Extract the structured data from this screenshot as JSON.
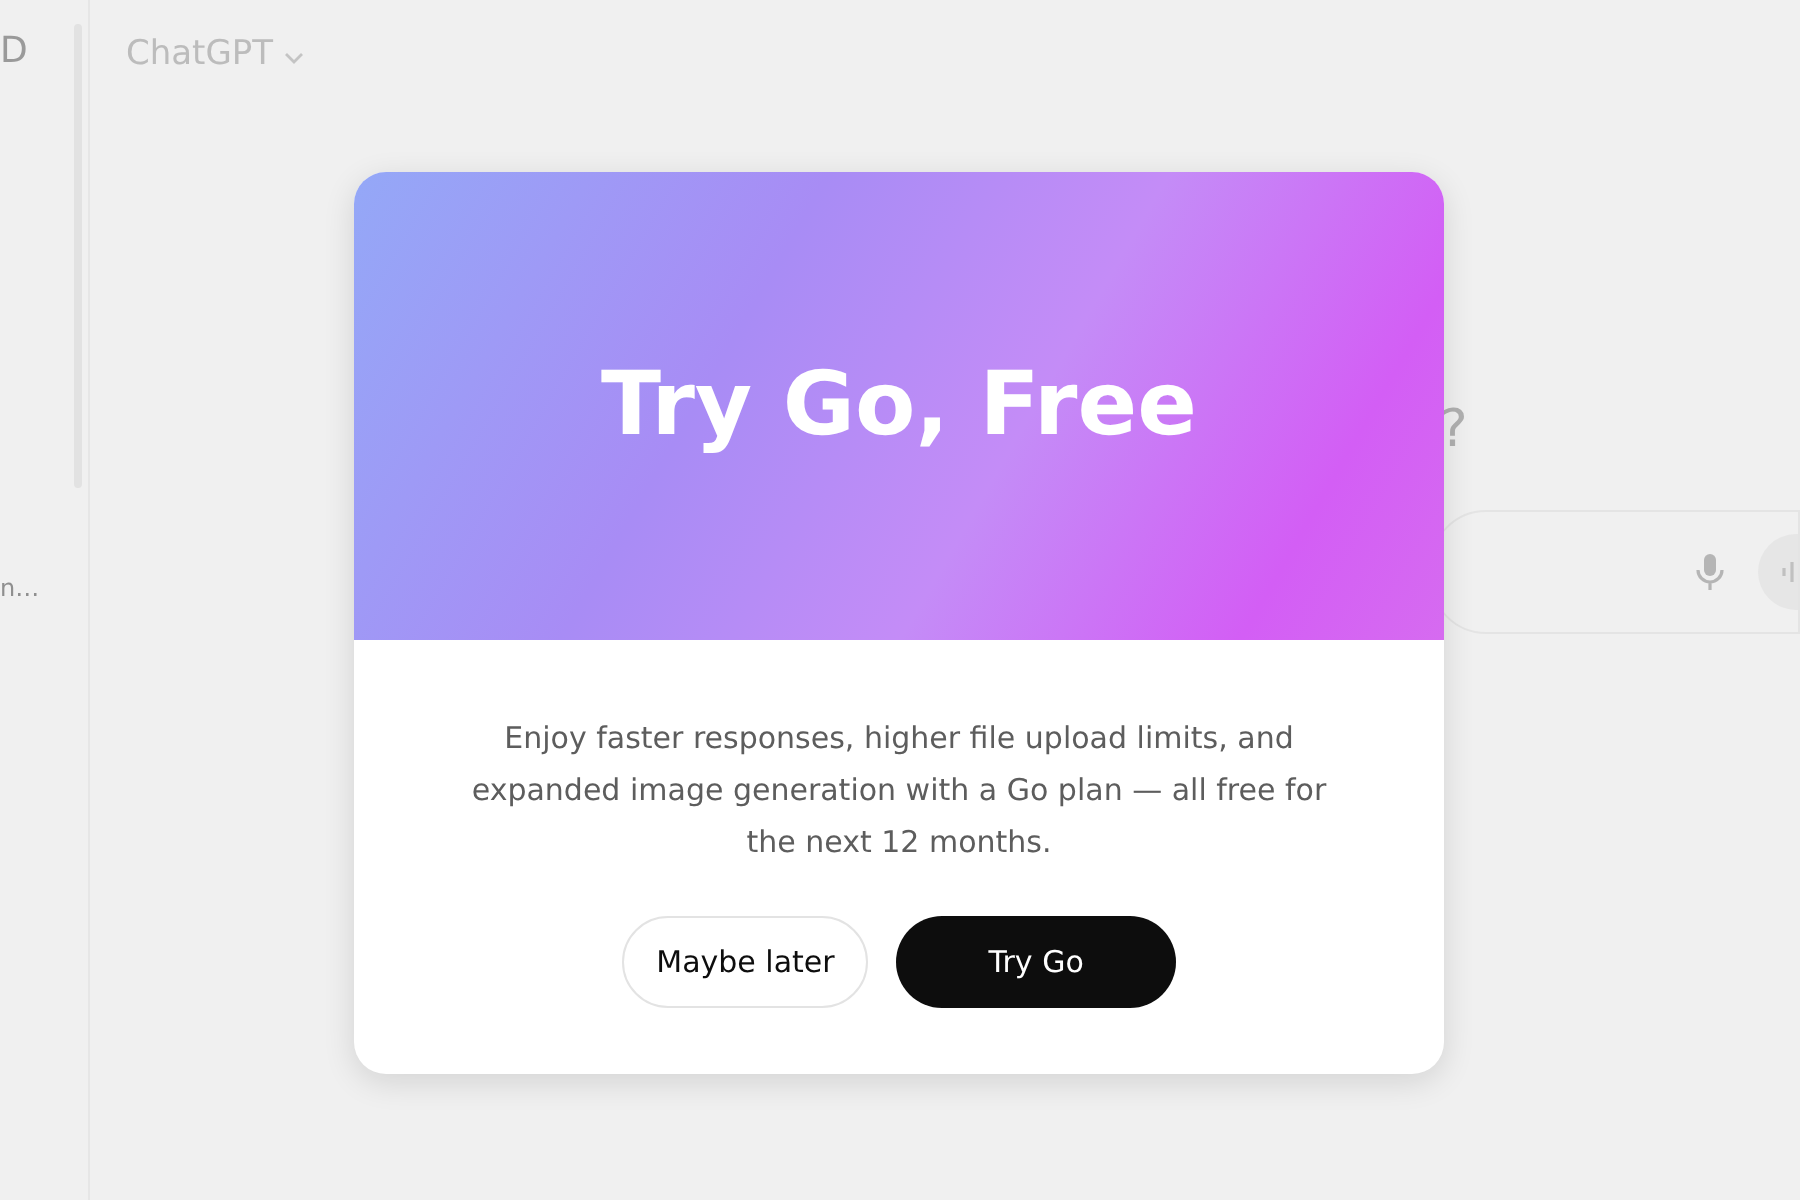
{
  "sidebar": {
    "items": [
      "D",
      "n…"
    ]
  },
  "header": {
    "title": "ChatGPT"
  },
  "main": {
    "heading": "?"
  },
  "dialog": {
    "title": "Try Go, Free",
    "body": "Enjoy faster responses, higher file upload limits, and expanded image generation with a Go plan — all free for the next 12 months.",
    "buttons": [
      {
        "label": "Maybe later",
        "kind": "secondary"
      },
      {
        "label": "Try Go",
        "kind": "primary"
      }
    ]
  }
}
